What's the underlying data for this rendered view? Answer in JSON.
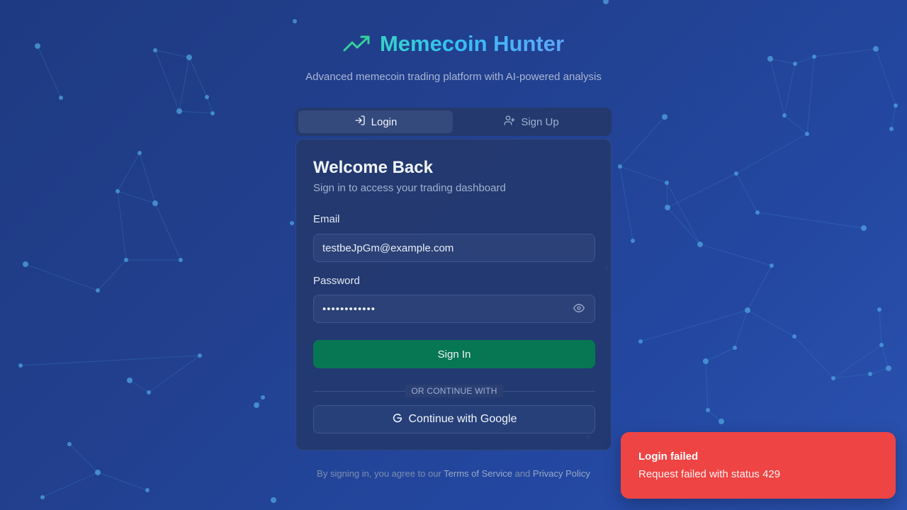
{
  "header": {
    "title": "Memecoin Hunter",
    "subtitle": "Advanced memecoin trading platform with AI-powered analysis",
    "logo_icon": "trending-up-icon",
    "accent": "#38bdf8"
  },
  "tabs": [
    {
      "label": "Login",
      "icon": "log-in-icon",
      "active": true
    },
    {
      "label": "Sign Up",
      "icon": "user-plus-icon",
      "active": false
    }
  ],
  "login_form": {
    "title": "Welcome Back",
    "description": "Sign in to access your trading dashboard",
    "email_label": "Email",
    "email_value": "testbeJpGm@example.com",
    "password_label": "Password",
    "password_value": "••••••••••••",
    "submit_label": "Sign In",
    "divider_text": "OR CONTINUE WITH",
    "google_label": "Continue with Google"
  },
  "footer": {
    "prefix": "By signing in, you agree to our ",
    "terms": "Terms of Service",
    "and": " and ",
    "privacy": "Privacy Policy"
  },
  "toast": {
    "title": "Login failed",
    "message": "Request failed with status 429",
    "color": "#ef4444"
  },
  "colors": {
    "primary_button": "#077753",
    "background": "#22408f"
  }
}
